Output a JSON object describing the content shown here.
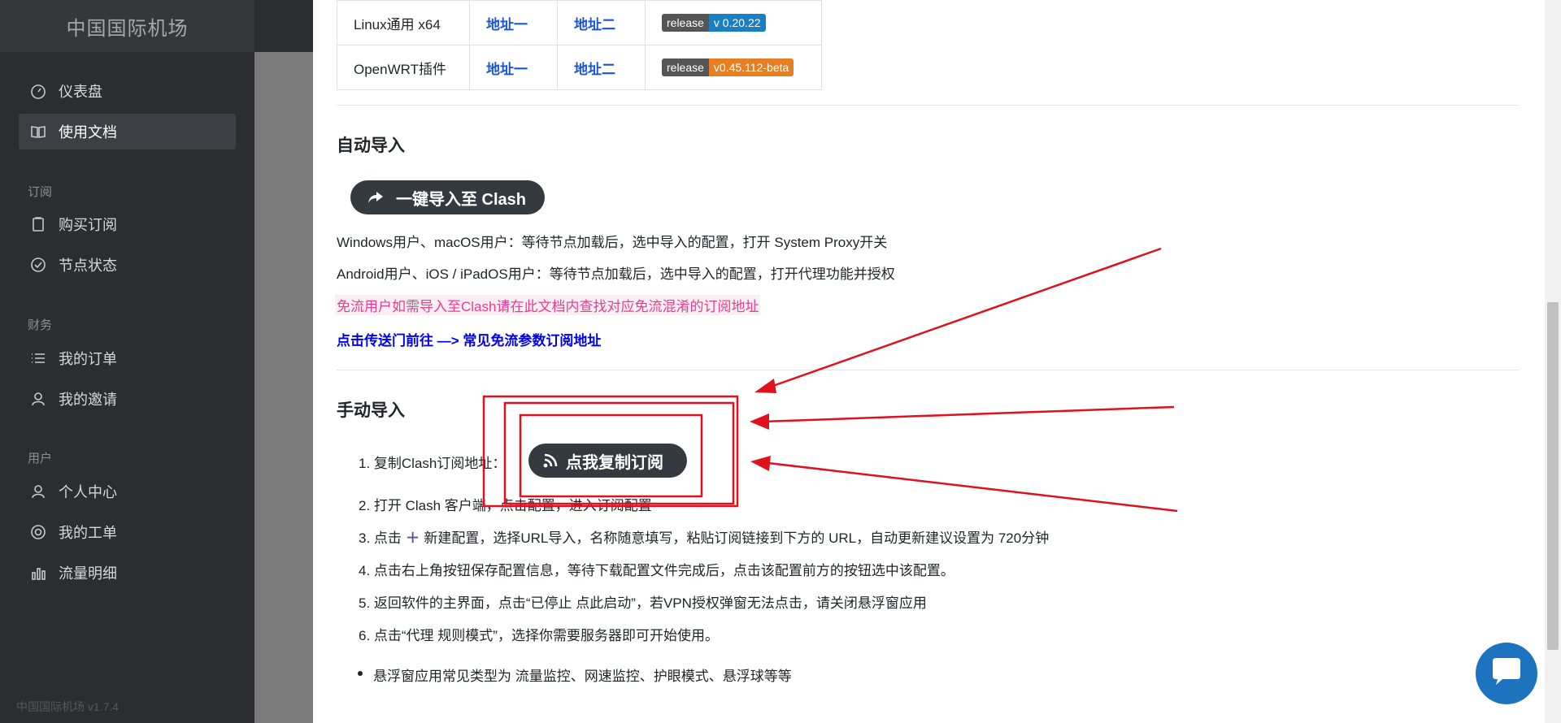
{
  "sidebar": {
    "brand": "中国国际机场",
    "items": [
      {
        "label": "仪表盘",
        "icon": "dashboard-icon",
        "active": false
      },
      {
        "label": "使用文档",
        "icon": "book-icon",
        "active": true
      }
    ],
    "sections": [
      {
        "heading": "订阅",
        "items": [
          {
            "label": "购买订阅",
            "icon": "clipboard-icon"
          },
          {
            "label": "节点状态",
            "icon": "check-circle-icon"
          }
        ]
      },
      {
        "heading": "财务",
        "items": [
          {
            "label": "我的订单",
            "icon": "list-icon"
          },
          {
            "label": "我的邀请",
            "icon": "users-icon"
          }
        ]
      },
      {
        "heading": "用户",
        "items": [
          {
            "label": "个人中心",
            "icon": "user-icon"
          },
          {
            "label": "我的工单",
            "icon": "support-icon"
          },
          {
            "label": "流量明细",
            "icon": "bar-chart-icon"
          }
        ]
      }
    ],
    "version": "中国国际机场 v1.7.4"
  },
  "downloads": [
    {
      "name": "Linux通用 x64",
      "addr1": "地址一",
      "addr2": "地址二",
      "badge_left": "release",
      "badge_right": "v 0.20.22",
      "badge_color": "#1a7fc1"
    },
    {
      "name": "OpenWRT插件",
      "addr1": "地址一",
      "addr2": "地址二",
      "badge_left": "release",
      "badge_right": "v0.45.112-beta",
      "badge_color": "#e67e22"
    }
  ],
  "auto_import": {
    "heading": "自动导入",
    "button_label": "一键导入至 Clash",
    "line1": "Windows用户、macOS用户：等待节点加载后，选中导入的配置，打开 System Proxy开关",
    "line2": "Android用户、iOS / iPadOS用户：等待节点加载后，选中导入的配置，打开代理功能并授权",
    "notice": "免流用户如需导入至Clash请在此文档内查找对应免流混淆的订阅地址",
    "link": "点击传送门前往 —> 常见免流参数订阅地址"
  },
  "manual_import": {
    "heading": "手动导入",
    "step1_label": "1. 复制Clash订阅地址：",
    "copy_button": "点我复制订阅",
    "step2": "2. 打开 Clash 客户端，点击配置，进入订阅配置",
    "step3_prefix": "3. 点击",
    "step3_suffix": "新建配置，选择URL导入，名称随意填写，粘贴订阅链接到下方的 URL，自动更新建议设置为 720分钟",
    "step4": "4. 点击右上角按钮保存配置信息，等待下载配置文件完成后，点击该配置前方的按钮选中该配置。",
    "step5": "5. 返回软件的主界面，点击“已停止 点此启动”，若VPN授权弹窗无法点击，请关闭悬浮窗应用",
    "step6": "6. 点击“代理 规则模式”，选择你需要服务器即可开始使用。",
    "bullet": "悬浮窗应用常见类型为 流量监控、网速监控、护眼模式、悬浮球等等"
  },
  "colors": {
    "sidebar_bg": "#2b2d31",
    "notice": "#e83e8c",
    "link": "#0000ee",
    "annotation": "#e0101c",
    "chat": "#1e73be"
  }
}
